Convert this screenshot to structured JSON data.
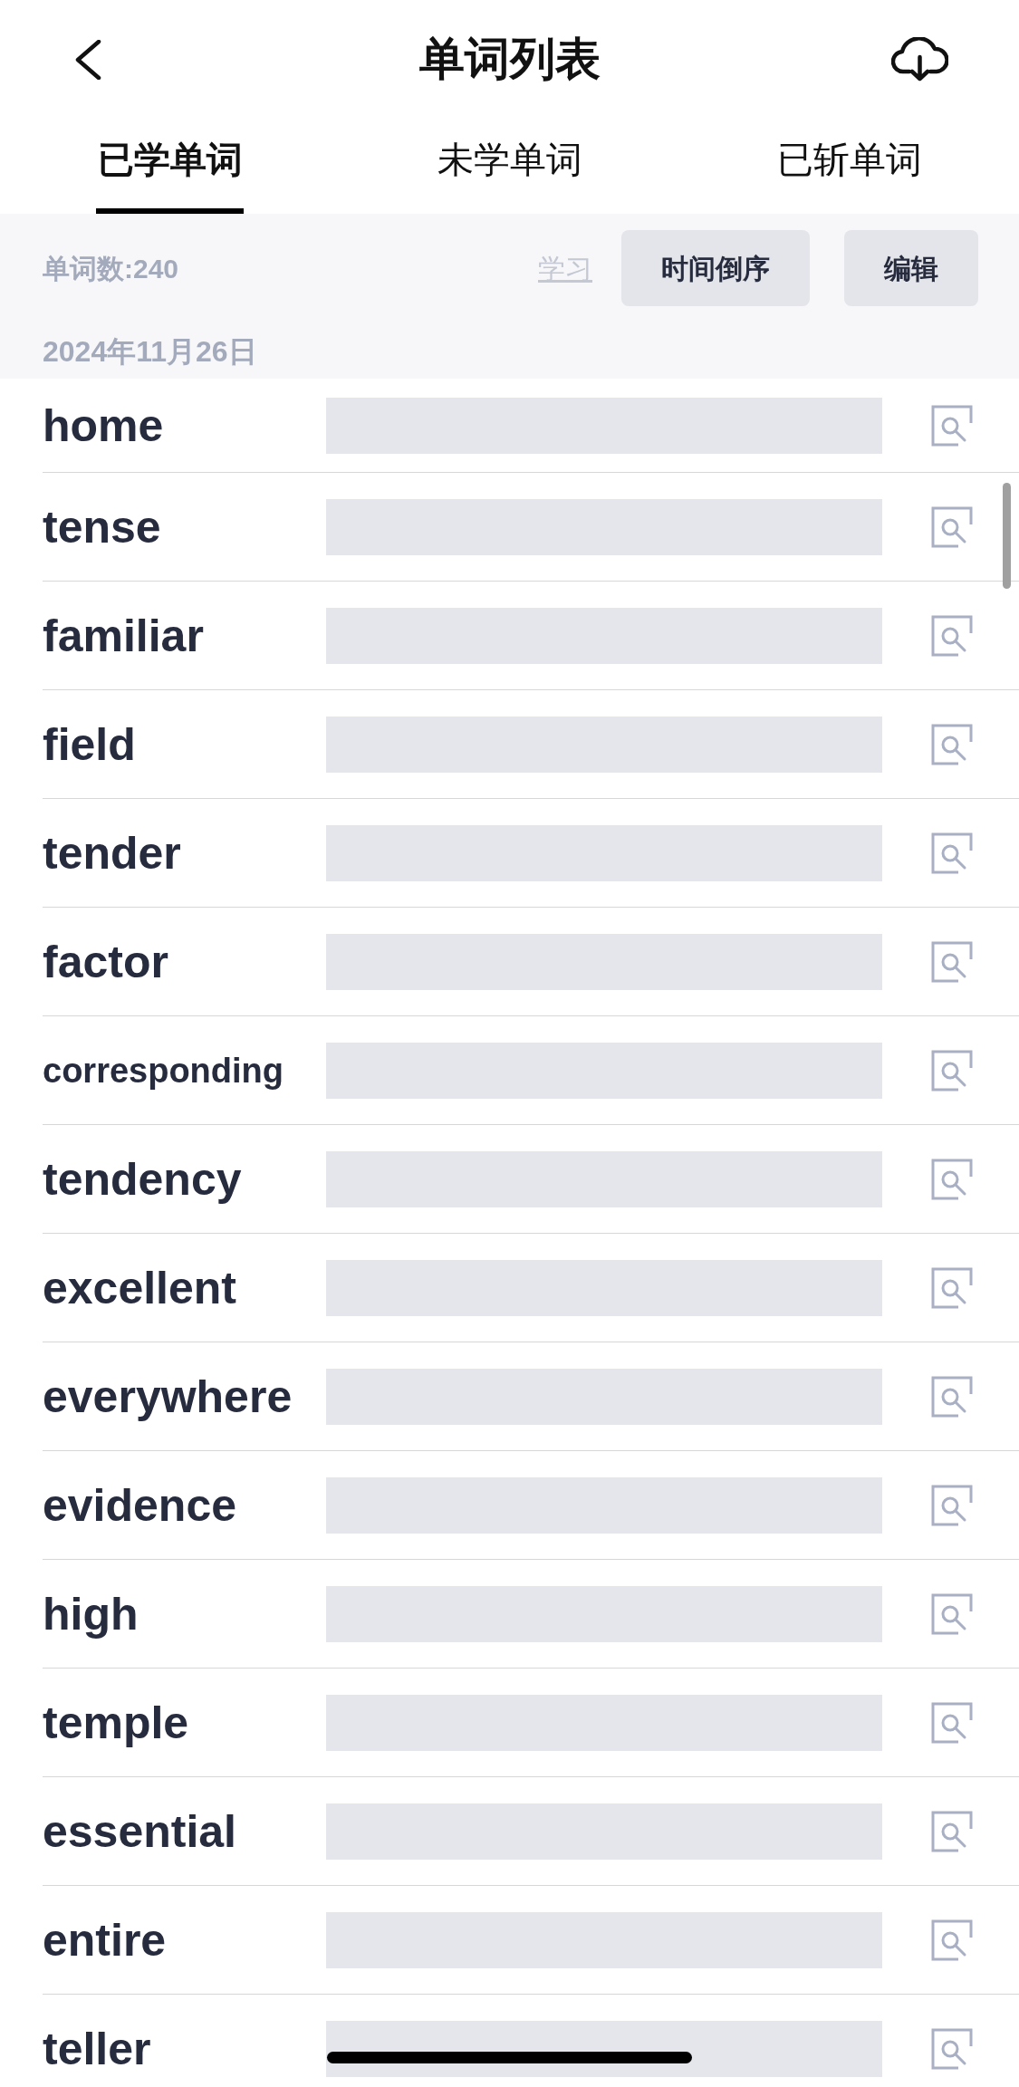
{
  "header": {
    "title": "单词列表"
  },
  "tabs": [
    {
      "label": "已学单词",
      "selected": true
    },
    {
      "label": "未学单词",
      "selected": false
    },
    {
      "label": "已斩单词",
      "selected": false
    }
  ],
  "toolbar": {
    "word_count": "单词数:240",
    "study_link": "学习",
    "buttons": [
      "时间倒序",
      "编辑"
    ]
  },
  "date": "2024年11月26日",
  "words": [
    "home",
    "tense",
    "familiar",
    "field",
    "tender",
    "factor",
    "corresponding",
    "tendency",
    "excellent",
    "everywhere",
    "evidence",
    "high",
    "temple",
    "essential",
    "entire",
    "teller"
  ]
}
